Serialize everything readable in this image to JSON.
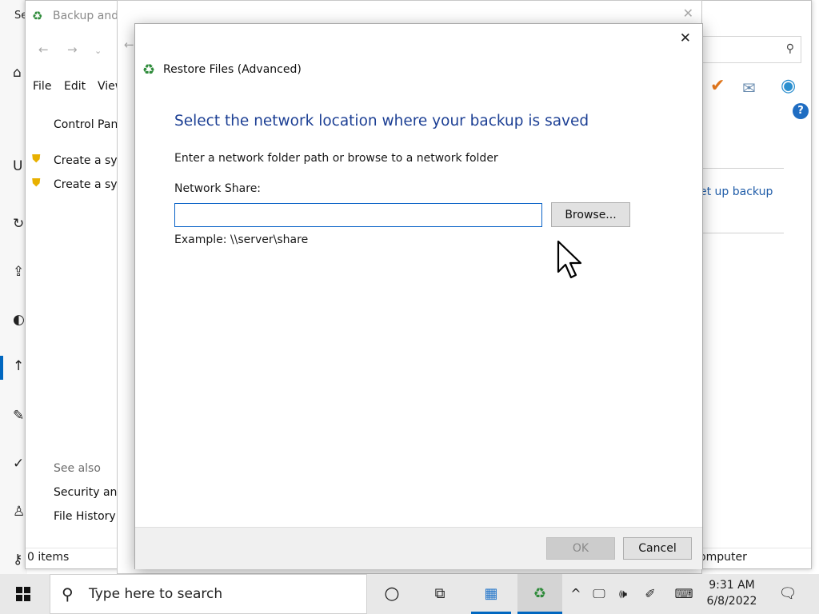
{
  "settings": {
    "title": "Se",
    "rail_icons": [
      "home-icon",
      "history-icon",
      "upload-icon",
      "shield-icon",
      "backup-icon",
      "wrench-icon",
      "check-icon",
      "person-icon",
      "key-icon"
    ],
    "section_letter": "U"
  },
  "cp_window": {
    "title": "Backup and",
    "menu": {
      "file": "File",
      "edit": "Edit",
      "view": "View"
    },
    "nav_home": "Control Pane",
    "nav_items": [
      "Create a syst",
      "Create a syst"
    ],
    "see_also": "See also",
    "see_also_items": [
      "Security and",
      "File History"
    ],
    "status_items": "0 items",
    "status_location": "omputer",
    "right_link": "et up backup"
  },
  "dialog": {
    "title": "Restore Files (Advanced)",
    "heading": "Select the network location where your backup is saved",
    "instruction": "Enter a network folder path or browse to a network folder",
    "network_share_label": "Network Share:",
    "network_share_value": "",
    "browse_label": "Browse...",
    "example": "Example: \\\\server\\share",
    "ok_label": "OK",
    "cancel_label": "Cancel"
  },
  "taskbar": {
    "search_placeholder": "Type here to search",
    "time": "9:31 AM",
    "date": "6/8/2022"
  },
  "colors": {
    "heading_blue": "#1c3f94",
    "accent": "#0067c0",
    "link_blue": "#1f5ca8"
  }
}
